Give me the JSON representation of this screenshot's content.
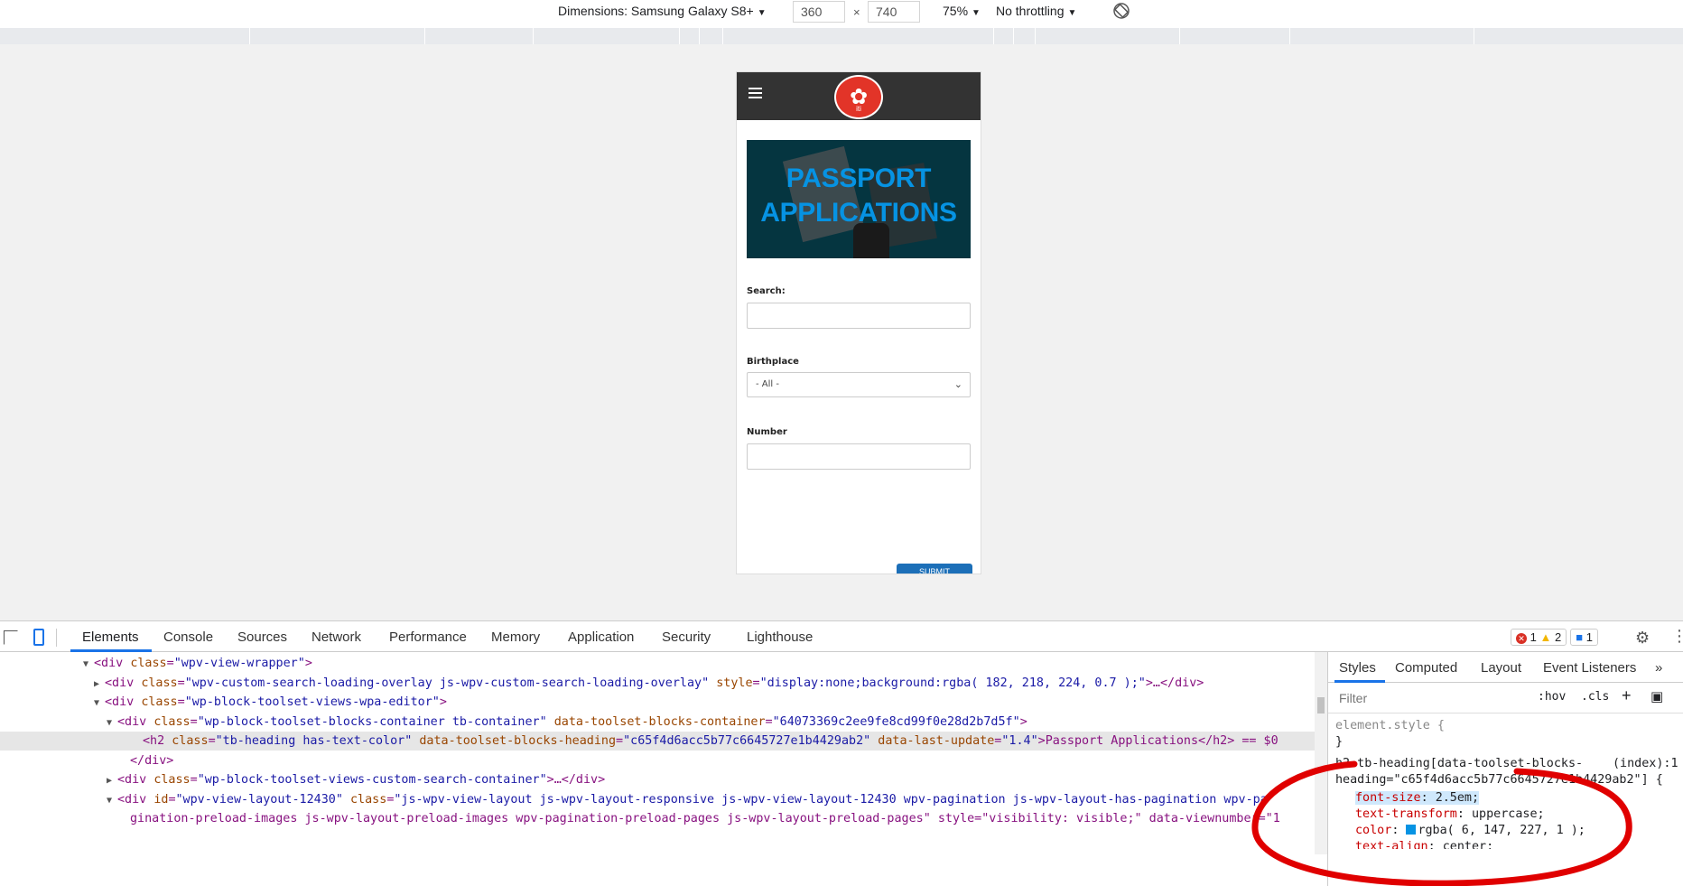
{
  "device_toolbar": {
    "dimensions_label": "Dimensions: Samsung Galaxy S8+",
    "width": "360",
    "height": "740",
    "times": "×",
    "zoom": "75%",
    "throttling": "No throttling"
  },
  "phone": {
    "banner_title_line1": "Passport",
    "banner_title_line2": "Applications",
    "fields": [
      {
        "label": "Search:"
      },
      {
        "label": "Birthplace",
        "selected": "- All -"
      },
      {
        "label": "Number"
      }
    ],
    "submit_label": "SUBMIT",
    "logo_text": "✿",
    "logo_small": "iti"
  },
  "devtools": {
    "tabs": [
      "Elements",
      "Console",
      "Sources",
      "Network",
      "Performance",
      "Memory",
      "Application",
      "Security",
      "Lighthouse"
    ],
    "active_tab": "Elements",
    "errors": "1",
    "warnings": "2",
    "messages": "1",
    "dom_lines": [
      {
        "tri": "▼",
        "tag": "div",
        "attrs": [
          {
            "name": "class",
            "value": "wpv-view-wrapper"
          }
        ],
        "tail": ">"
      },
      {
        "tri": "▶",
        "tag": "div",
        "attrs": [
          {
            "name": "class",
            "value": "wpv-custom-search-loading-overlay js-wpv-custom-search-loading-overlay"
          },
          {
            "name": "style",
            "value": "display:none;background:rgba( 182, 218, 224, 0.7 );"
          }
        ],
        "tail": ">…</div>"
      },
      {
        "tri": "▼",
        "tag": "div",
        "attrs": [
          {
            "name": "class",
            "value": "wp-block-toolset-views-wpa-editor"
          }
        ],
        "tail": ">"
      },
      {
        "tri": "▼",
        "tag": "div",
        "attrs": [
          {
            "name": "class",
            "value": "wp-block-toolset-blocks-container tb-container"
          },
          {
            "name": "data-toolset-blocks-container",
            "value": "64073369c2ee9fe8cd99f0e28d2b7d5f"
          }
        ],
        "tail": ">"
      },
      {
        "tri": "",
        "tag": "h2",
        "attrs": [
          {
            "name": "class",
            "value": "tb-heading has-text-color"
          },
          {
            "name": "data-toolset-blocks-heading",
            "value": "c65f4d6acc5b77c6645727e1b4429ab2"
          },
          {
            "name": "data-last-update",
            "value": "1.4"
          }
        ],
        "tail": ">Passport Applications</h2> == $0"
      },
      {
        "tri": "",
        "tag": "",
        "attrs": [],
        "tail": "</div>"
      },
      {
        "tri": "▶",
        "tag": "div",
        "attrs": [
          {
            "name": "class",
            "value": "wp-block-toolset-views-custom-search-container"
          }
        ],
        "tail": ">…</div>"
      },
      {
        "tri": "▼",
        "tag": "div",
        "attrs": [
          {
            "name": "id",
            "value": "wpv-view-layout-12430"
          },
          {
            "name": "class",
            "value": "js-wpv-view-layout js-wpv-layout-responsive js-wpv-view-layout-12430 wpv-pagination js-wpv-layout-has-pagination wpv-pa"
          }
        ],
        "tail": ""
      },
      {
        "tri": "",
        "tag": "",
        "attrs": [],
        "tail": "gination-preload-images js-wpv-layout-preload-images wpv-pagination-preload-pages js-wpv-layout-preload-pages\" style=\"visibility: visible;\" data-viewnumber=\"1"
      }
    ],
    "styles_tabs": [
      "Styles",
      "Computed",
      "Layout",
      "Event Listeners"
    ],
    "filter_placeholder": "Filter",
    "hov": ":hov",
    "cls": ".cls",
    "element_style": "element.style {",
    "element_style_close": "}",
    "rule_selector_1": "h2.tb-heading[data-toolset-blocks-",
    "rule_selector_2": "heading=\"c65f4d6acc5b77c6645727e1b4429ab2\"] {",
    "rule_source": "(index):1",
    "properties": [
      {
        "name": "font-size",
        "value": "2.5em;"
      },
      {
        "name": "text-transform",
        "value": "uppercase;"
      },
      {
        "name": "color",
        "value": "rgba( 6, 147, 227, 1 );"
      },
      {
        "name": "text-align",
        "value": "center;"
      }
    ],
    "swatch_color": "#0693e3"
  }
}
